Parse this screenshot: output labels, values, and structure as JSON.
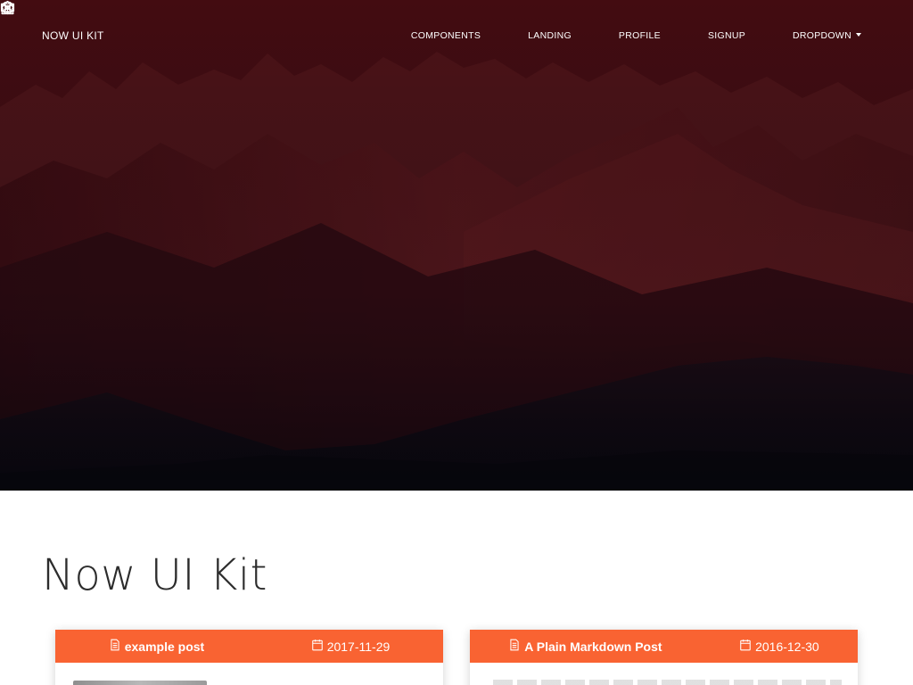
{
  "navbar": {
    "brand": "NOW UI KIT",
    "items": [
      {
        "label": "COMPONENTS",
        "icon": "cube-icon"
      },
      {
        "label": "LANDING",
        "icon": "bank-icon"
      },
      {
        "label": "PROFILE",
        "icon": "user-icon"
      },
      {
        "label": "SIGNUP",
        "icon": "ticket-icon"
      },
      {
        "label": "DROPDOWN",
        "icon": "gear-icon",
        "has_caret": true
      }
    ]
  },
  "main": {
    "title": "Now UI Kit",
    "posts": [
      {
        "title": "example post",
        "date": "2017-11-29",
        "title_icon": "document-icon",
        "date_icon": "calendar-icon"
      },
      {
        "title": "A Plain Markdown Post",
        "date": "2016-12-30",
        "title_icon": "document-icon",
        "date_icon": "calendar-icon"
      }
    ]
  },
  "colors": {
    "accent": "#f96332",
    "hero_dark": "#3a0d12"
  }
}
